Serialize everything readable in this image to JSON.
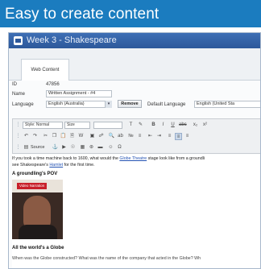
{
  "banner": {
    "title": "Easy to create content",
    "color": "#1b7cbf"
  },
  "window": {
    "title": "Week 3 - Shakespeare"
  },
  "tabs": [
    {
      "label": "Web Content"
    }
  ],
  "form": {
    "id_label": "ID",
    "id_value": "47856",
    "name_label": "Name",
    "name_value": "Written Assignment - #4",
    "language_label": "Language",
    "language_value": "English (Australia)",
    "remove_label": "Remove",
    "default_language_label": "Default Language",
    "default_language_value": "English (United Sta"
  },
  "toolbar": {
    "style_label": "Style",
    "style_value": "Normal",
    "size_label": "Size",
    "source_label": "Source",
    "icons": [
      "bold-icon",
      "italic-icon",
      "underline-icon",
      "strikethrough-icon",
      "bullet-list-icon",
      "numbered-list-icon",
      "align-left-icon",
      "align-center-icon",
      "link-icon",
      "image-icon",
      "table-icon",
      "undo-icon",
      "redo-icon"
    ]
  },
  "content": {
    "intro_before": "If you took a time machine back to 1600, what would the ",
    "intro_link": "Globe Theatre",
    "intro_after": " stage look like from a groundli",
    "line2_before": "see Shakespeare's ",
    "line2_link": "Hamlet",
    "line2_after": " for the first time.",
    "heading1": "A groundling's POV",
    "video_badge": "Video Narration",
    "heading2": "All the world's a Globe",
    "line3": "When was the Globe constructed? What was the name of the company that acted in the Globe? Wh"
  }
}
